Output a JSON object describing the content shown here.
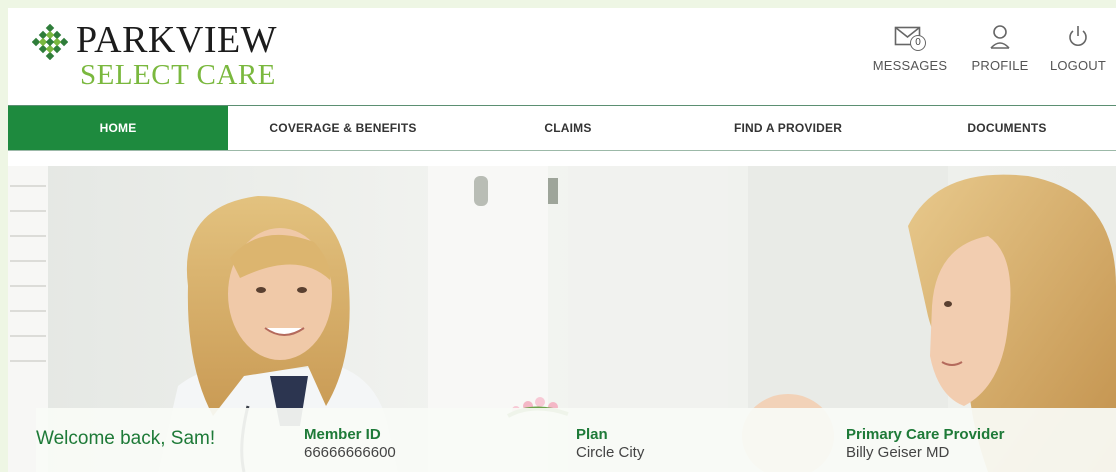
{
  "brand": {
    "line1": "PARKVIEW",
    "line2": "SELECT CARE",
    "accent": "#1e8a3e",
    "secondary": "#7ab83e"
  },
  "header_actions": [
    {
      "label": "MESSAGES",
      "icon": "envelope-icon",
      "badge": "0"
    },
    {
      "label": "PROFILE",
      "icon": "user-icon"
    },
    {
      "label": "LOGOUT",
      "icon": "power-icon"
    }
  ],
  "nav": {
    "tabs": [
      {
        "label": "HOME",
        "active": true
      },
      {
        "label": "COVERAGE & BENEFITS"
      },
      {
        "label": "CLAIMS"
      },
      {
        "label": "FIND A PROVIDER"
      },
      {
        "label": "DOCUMENTS"
      }
    ]
  },
  "member": {
    "welcome": "Welcome back, Sam!",
    "member_id_label": "Member ID",
    "member_id": "66666666600",
    "plan_label": "Plan",
    "plan": "Circle City",
    "pcp_label": "Primary Care Provider",
    "pcp": "Billy Geiser MD"
  }
}
